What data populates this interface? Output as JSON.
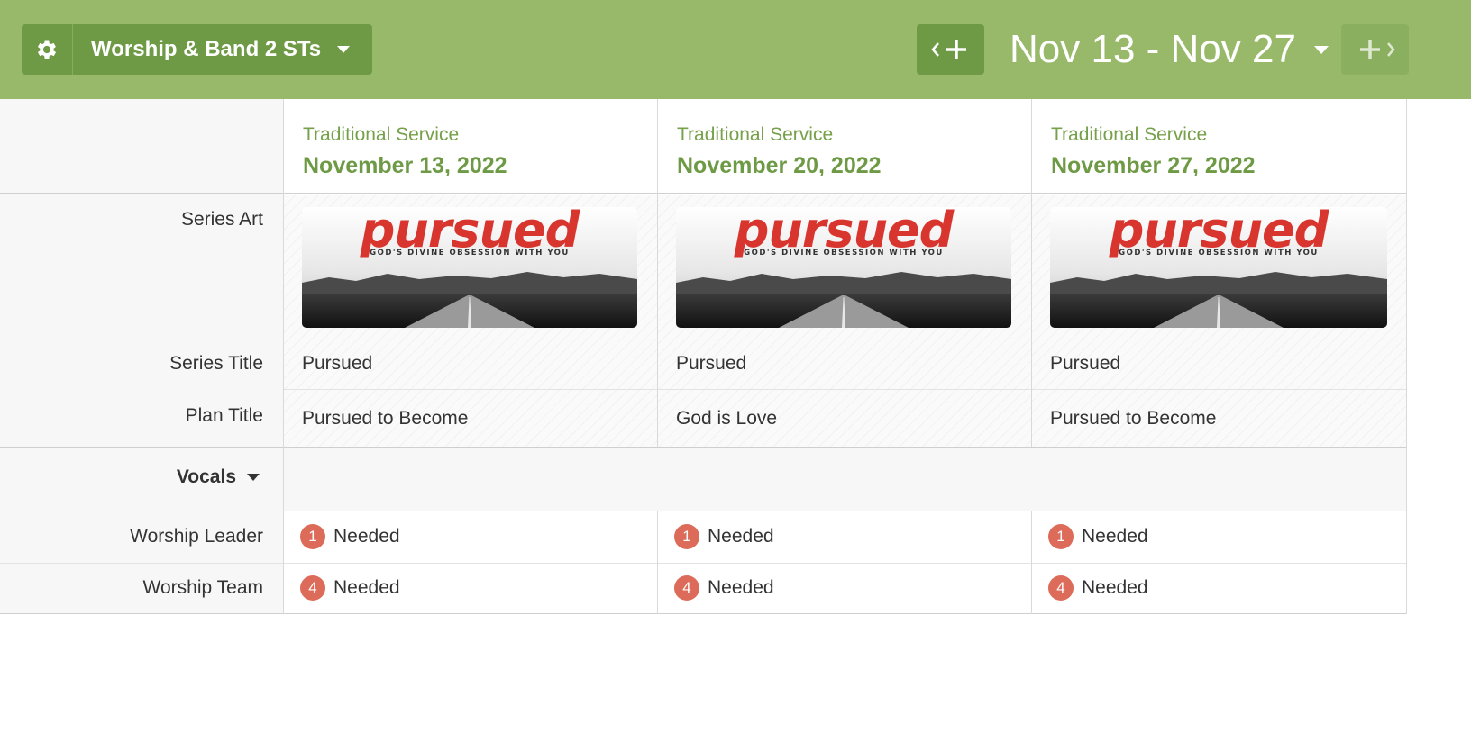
{
  "header": {
    "team_name": "Worship & Band 2 STs",
    "date_range": "Nov 13 - Nov 27",
    "settings_icon": "gear-icon",
    "add_previous_icon": "add-previous-week-icon",
    "add_next_icon": "add-next-week-icon",
    "brand_color": "#98b96a"
  },
  "row_labels": {
    "series_art": "Series Art",
    "series_title": "Series Title",
    "plan_title": "Plan Title",
    "vocals": "Vocals",
    "worship_leader": "Worship Leader",
    "worship_team": "Worship Team"
  },
  "plans": [
    {
      "service_type": "Traditional Service",
      "date": "November 13, 2022",
      "art": {
        "title": "pursued",
        "tagline": "GOD'S DIVINE OBSESSION WITH YOU"
      },
      "series_title": "Pursued",
      "plan_title": "Pursued to Become",
      "worship_leader": {
        "count": "1",
        "status": "Needed"
      },
      "worship_team": {
        "count": "4",
        "status": "Needed"
      }
    },
    {
      "service_type": "Traditional Service",
      "date": "November 20, 2022",
      "art": {
        "title": "pursued",
        "tagline": "GOD'S DIVINE OBSESSION WITH YOU"
      },
      "series_title": "Pursued",
      "plan_title": "God is Love",
      "worship_leader": {
        "count": "1",
        "status": "Needed"
      },
      "worship_team": {
        "count": "4",
        "status": "Needed"
      }
    },
    {
      "service_type": "Traditional Service",
      "date": "November 27, 2022",
      "art": {
        "title": "pursued",
        "tagline": "GOD'S DIVINE OBSESSION WITH YOU"
      },
      "series_title": "Pursued",
      "plan_title": "Pursued to Become",
      "worship_leader": {
        "count": "1",
        "status": "Needed"
      },
      "worship_team": {
        "count": "4",
        "status": "Needed"
      }
    }
  ],
  "colors": {
    "accent_green": "#6e9a45",
    "needed_badge": "#dd6b59",
    "art_title_red": "#d9352f"
  }
}
